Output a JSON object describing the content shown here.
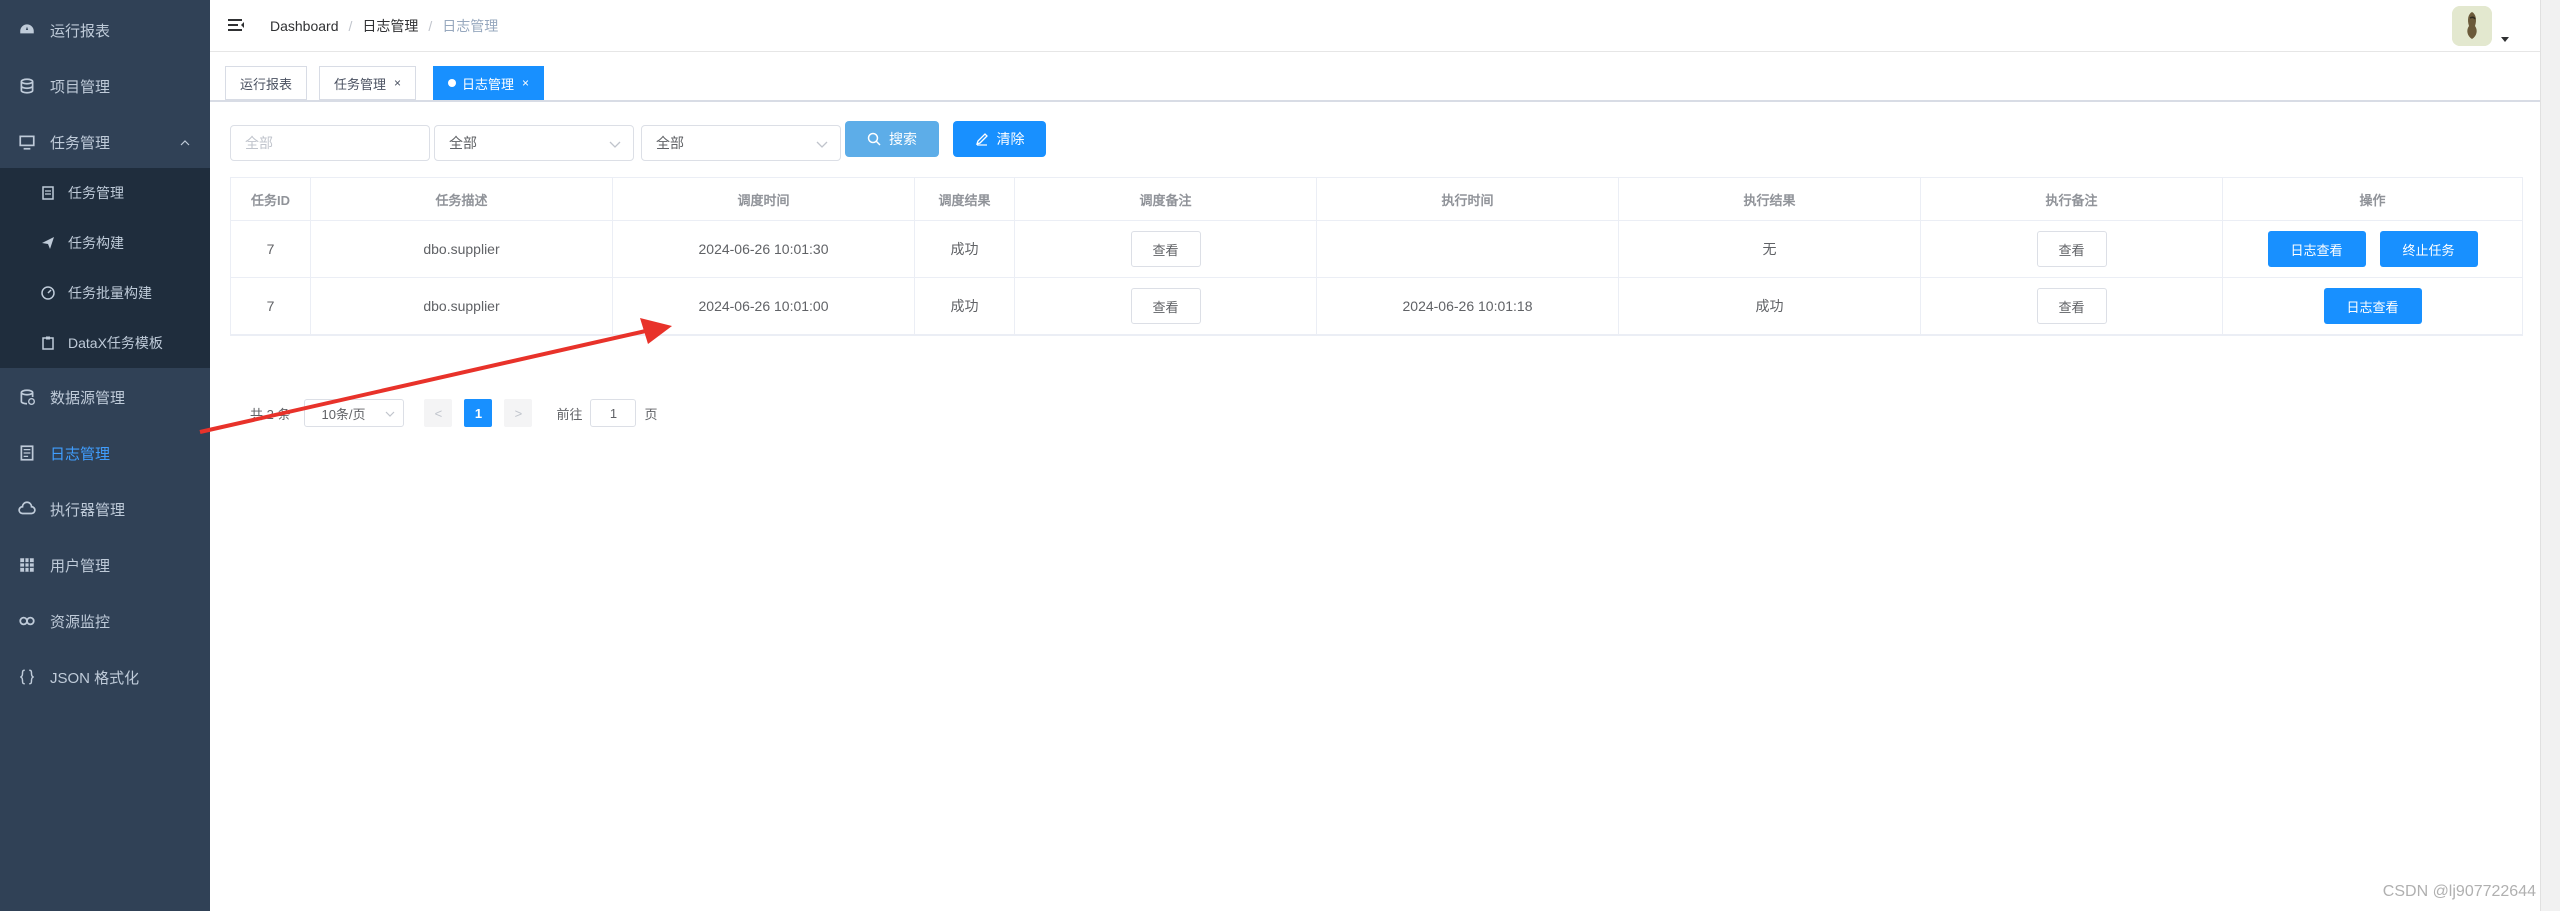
{
  "sidebar": {
    "items": [
      {
        "label": "运行报表",
        "icon": "dashboard-icon"
      },
      {
        "label": "项目管理",
        "icon": "database-icon"
      },
      {
        "label": "任务管理",
        "icon": "monitor-icon"
      },
      {
        "label": "数据源管理",
        "icon": "datasource-icon"
      },
      {
        "label": "日志管理",
        "icon": "document-icon"
      },
      {
        "label": "执行器管理",
        "icon": "cloud-icon"
      },
      {
        "label": "用户管理",
        "icon": "grid-icon"
      },
      {
        "label": "资源监控",
        "icon": "link-icon"
      },
      {
        "label": "JSON 格式化",
        "icon": "braces-icon"
      }
    ],
    "subitems": [
      {
        "label": "任务管理",
        "icon": "tasklist-icon"
      },
      {
        "label": "任务构建",
        "icon": "send-icon"
      },
      {
        "label": "任务批量构建",
        "icon": "gauge-icon"
      },
      {
        "label": "DataX任务模板",
        "icon": "clipboard-icon"
      }
    ],
    "active_color": "#409eff"
  },
  "breadcrumb": [
    "Dashboard",
    "日志管理",
    "日志管理"
  ],
  "tags": [
    {
      "label": "运行报表"
    },
    {
      "label": "任务管理",
      "close": "×"
    },
    {
      "label": "日志管理",
      "close": "×"
    }
  ],
  "filters": {
    "input_placeholder": "全部",
    "select1": "全部",
    "select2": "全部",
    "search_label": "搜索",
    "clear_label": "清除"
  },
  "table": {
    "headers": [
      "任务ID",
      "任务描述",
      "调度时间",
      "调度结果",
      "调度备注",
      "执行时间",
      "执行结果",
      "执行备注",
      "操作"
    ],
    "rows": [
      {
        "id": "7",
        "desc": "dbo.supplier",
        "trigger_time": "2024-06-26 10:01:30",
        "trigger_result": "成功",
        "trigger_note": "查看",
        "exec_time": "",
        "exec_result": "无",
        "exec_note": "查看",
        "ops": [
          "日志查看",
          "终止任务"
        ]
      },
      {
        "id": "7",
        "desc": "dbo.supplier",
        "trigger_time": "2024-06-26 10:01:00",
        "trigger_result": "成功",
        "trigger_note": "查看",
        "exec_time": "2024-06-26 10:01:18",
        "exec_result": "成功",
        "exec_note": "查看",
        "ops": [
          "日志查看"
        ]
      }
    ]
  },
  "pagination": {
    "total": "共 2 条",
    "page_size": "10条/页",
    "prev": "<",
    "current": "1",
    "next": ">",
    "goto_label": "前往",
    "goto_value": "1",
    "page_suffix": "页"
  },
  "watermark": "CSDN @lj907722644",
  "colors": {
    "primary": "#1890ff",
    "sidebar_bg": "#304156",
    "annotation_arrow": "#e8322a"
  }
}
